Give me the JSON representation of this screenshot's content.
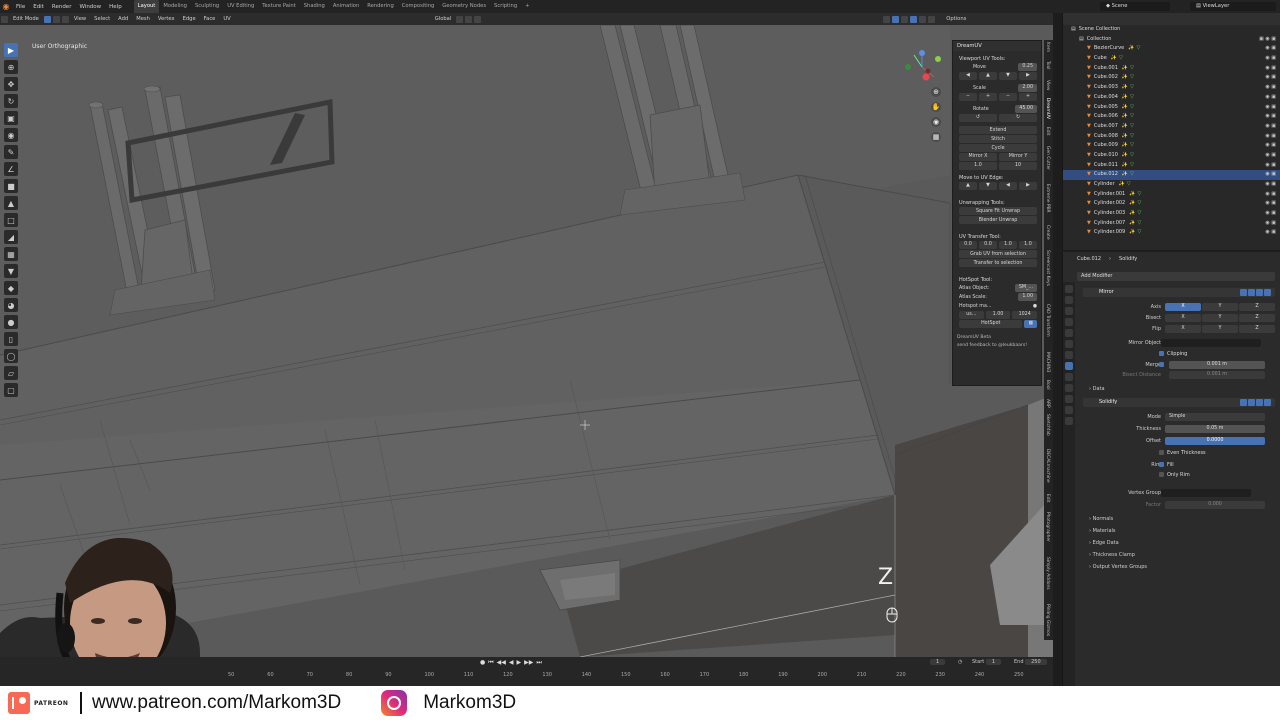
{
  "menubar": {
    "items": [
      "File",
      "Edit",
      "Render",
      "Window",
      "Help"
    ],
    "workspaces": [
      "Layout",
      "Modeling",
      "Sculpting",
      "UV Editing",
      "Texture Paint",
      "Shading",
      "Animation",
      "Rendering",
      "Compositing",
      "Geometry Nodes",
      "Scripting"
    ],
    "add_tab": "+",
    "scene": "Scene",
    "view_layer": "ViewLayer"
  },
  "viewport_header": {
    "mode": "Edit Mode",
    "menus": [
      "View",
      "Select",
      "Add",
      "Mesh",
      "Vertex",
      "Edge",
      "Face",
      "UV"
    ],
    "transform_space": "Global",
    "options": "Options"
  },
  "viewport": {
    "title": "User Orthographic",
    "key_hint": "Z"
  },
  "dreamuv": {
    "title": "DreamUV",
    "viewport_tools": "Viewport UV Tools:",
    "move_label": "Move",
    "move_value": "0.25",
    "scale_label": "Scale",
    "scale_value": "2.00",
    "rotate_label": "Rotate",
    "rotate_value": "45.00",
    "extend": "Extend",
    "stitch": "Stitch",
    "cycle": "Cycle",
    "mirror_x": "Mirror X",
    "mirror_y": "Mirror Y",
    "move_to_edge": "Move to UV Edge:",
    "unwrapping_tools": "Unwrapping Tools:",
    "square_fit": "Square Fit Unwrap",
    "blender_unwrap": "Blender Unwrap",
    "transfer_tool": "UV Transfer Tool:",
    "transfer_vals": [
      "0.0",
      "0.0",
      "1.0",
      "1.0"
    ],
    "grab_uv": "Grab UV from selection",
    "transfer_sel": "Transfer to selection",
    "hotspot_tool": "HotSpot Tool:",
    "atlas_object": "Atlas Object:",
    "atlas_object_val": "SM_...",
    "atlas_scale": "Atlas Scale:",
    "atlas_scale_val": "1.00",
    "hotspot_ma": "Hotspot ma...",
    "us_label": "us...",
    "us_val1": "1.00",
    "us_val2": "1024",
    "hotspot_btn": "HotSpot",
    "beta": "DreamUV Beta",
    "feedback": "send feedback to @leukbaars!"
  },
  "sidetabs": [
    "Item",
    "Tool",
    "View",
    "DreamUV",
    "Edit",
    "Gen Cutter",
    "Extreme PBR",
    "Create",
    "Screencast Keys",
    "CAD Transform",
    "MACHIN3",
    "Bool",
    "ARP",
    "Sketchfab",
    "DECALmachine",
    "Edit",
    "Photographer",
    "Simply Addons",
    "Pinling Gizmos"
  ],
  "timeline": {
    "ruler": [
      "50",
      "60",
      "70",
      "80",
      "90",
      "100",
      "110",
      "120",
      "130",
      "140",
      "150",
      "160",
      "170",
      "180",
      "190",
      "200",
      "210",
      "220",
      "230",
      "240",
      "250"
    ],
    "current_frame": "1",
    "start_label": "Start",
    "start_value": "1",
    "end_label": "End",
    "end_value": "250"
  },
  "outliner": {
    "scene_collection": "Scene Collection",
    "collection": "Collection",
    "items": [
      {
        "name": "BezierCurve",
        "sel": false
      },
      {
        "name": "Cube",
        "sel": false
      },
      {
        "name": "Cube.001",
        "sel": false
      },
      {
        "name": "Cube.002",
        "sel": false
      },
      {
        "name": "Cube.003",
        "sel": false
      },
      {
        "name": "Cube.004",
        "sel": false
      },
      {
        "name": "Cube.005",
        "sel": false
      },
      {
        "name": "Cube.006",
        "sel": false
      },
      {
        "name": "Cube.007",
        "sel": false
      },
      {
        "name": "Cube.008",
        "sel": false
      },
      {
        "name": "Cube.009",
        "sel": false
      },
      {
        "name": "Cube.010",
        "sel": false
      },
      {
        "name": "Cube.011",
        "sel": false
      },
      {
        "name": "Cube.012",
        "sel": true
      },
      {
        "name": "Cylinder",
        "sel": false
      },
      {
        "name": "Cylinder.001",
        "sel": false
      },
      {
        "name": "Cylinder.002",
        "sel": false
      },
      {
        "name": "Cylinder.003",
        "sel": false
      },
      {
        "name": "Cylinder.007",
        "sel": false
      },
      {
        "name": "Cylinder.009",
        "sel": false
      }
    ]
  },
  "properties": {
    "object": "Cube.012",
    "modifier_name": "Solidify",
    "add_modifier": "Add Modifier",
    "mirror": {
      "name": "Mirror",
      "axis": "Axis",
      "bisect": "Bisect",
      "flip": "Flip",
      "x": "X",
      "y": "Y",
      "z": "Z",
      "mirror_object": "Mirror Object",
      "clipping": "Clipping",
      "merge": "Merge",
      "merge_val": "0.001 m",
      "bisect_distance": "Bisect Distance",
      "bisect_distance_val": "0.001 m",
      "data": "Data"
    },
    "solidify": {
      "name": "Solidify",
      "mode": "Mode",
      "mode_val": "Simple",
      "thickness": "Thickness",
      "thickness_val": "0.05 m",
      "offset": "Offset",
      "offset_val": "0.0000",
      "even_thickness": "Even Thickness",
      "rim": "Rim",
      "fill": "Fill",
      "only_rim": "Only Rim",
      "vertex_group": "Vertex Group",
      "factor": "Factor",
      "factor_val": "0.000"
    },
    "subpanels": [
      "Normals",
      "Materials",
      "Edge Data",
      "Thickness Clamp",
      "Output Vertex Groups"
    ]
  },
  "brand": {
    "patreon_word": "PATREON",
    "url": "www.patreon.com/Markom3D",
    "handle": "Markom3D"
  },
  "colors": {
    "accent": "#4772b3",
    "selected_row": "#334d80",
    "patreon": "#f96854",
    "viewport": "#5a5a5a"
  }
}
